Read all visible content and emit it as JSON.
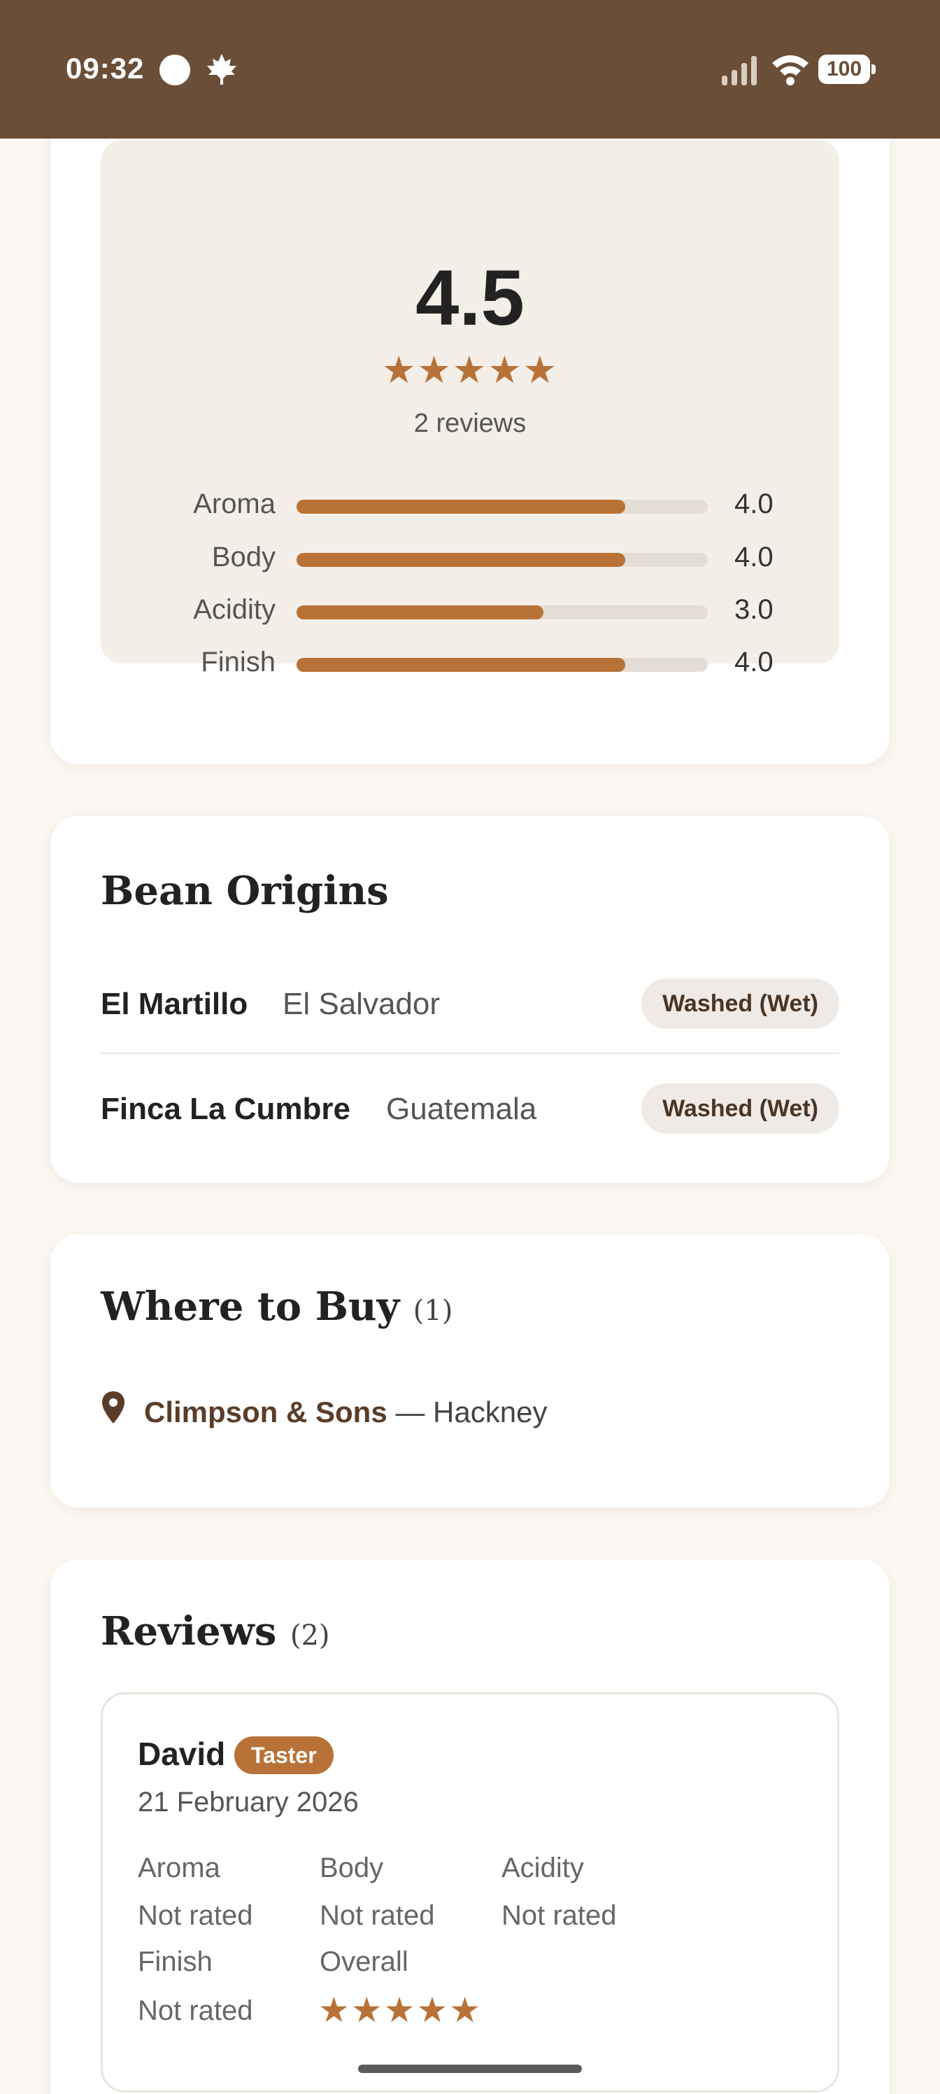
{
  "status_bar": {
    "time": "09:32",
    "battery": "100",
    "icons": [
      "circle-icon",
      "maple-leaf-icon",
      "signal-icon",
      "wifi-icon",
      "battery-icon"
    ]
  },
  "summary": {
    "rating": "4.5",
    "stars": "★★★★★",
    "review_count": "2 reviews",
    "attributes": [
      {
        "label": "Aroma",
        "value": "4.0",
        "score": 4.0
      },
      {
        "label": "Body",
        "value": "4.0",
        "score": 4.0
      },
      {
        "label": "Acidity",
        "value": "3.0",
        "score": 3.0
      },
      {
        "label": "Finish",
        "value": "4.0",
        "score": 4.0
      }
    ],
    "max_score": 5
  },
  "origins": {
    "title": "Bean Origins",
    "items": [
      {
        "farm": "El Martillo",
        "country": "El Salvador",
        "process": "Washed (Wet)"
      },
      {
        "farm": "Finca La Cumbre",
        "country": "Guatemala",
        "process": "Washed (Wet)"
      }
    ]
  },
  "where_to_buy": {
    "title": "Where to Buy",
    "count": "(1)",
    "shops": [
      {
        "name": "Climpson & Sons",
        "location": " — Hackney"
      }
    ]
  },
  "reviews": {
    "title": "Reviews",
    "count": "(2)",
    "items": [
      {
        "name": "David",
        "badge": "Taster",
        "date": "21 February 2026",
        "aroma_label": "Aroma",
        "aroma_value": "Not rated",
        "body_label": "Body",
        "body_value": "Not rated",
        "acidity_label": "Acidity",
        "acidity_value": "Not rated",
        "finish_label": "Finish",
        "finish_value": "Not rated",
        "overall_label": "Overall",
        "overall_stars": "★★★★★"
      }
    ]
  },
  "colors": {
    "status_bar": "#6b4e37",
    "accent": "#b87237",
    "background": "#fcf7f2"
  }
}
